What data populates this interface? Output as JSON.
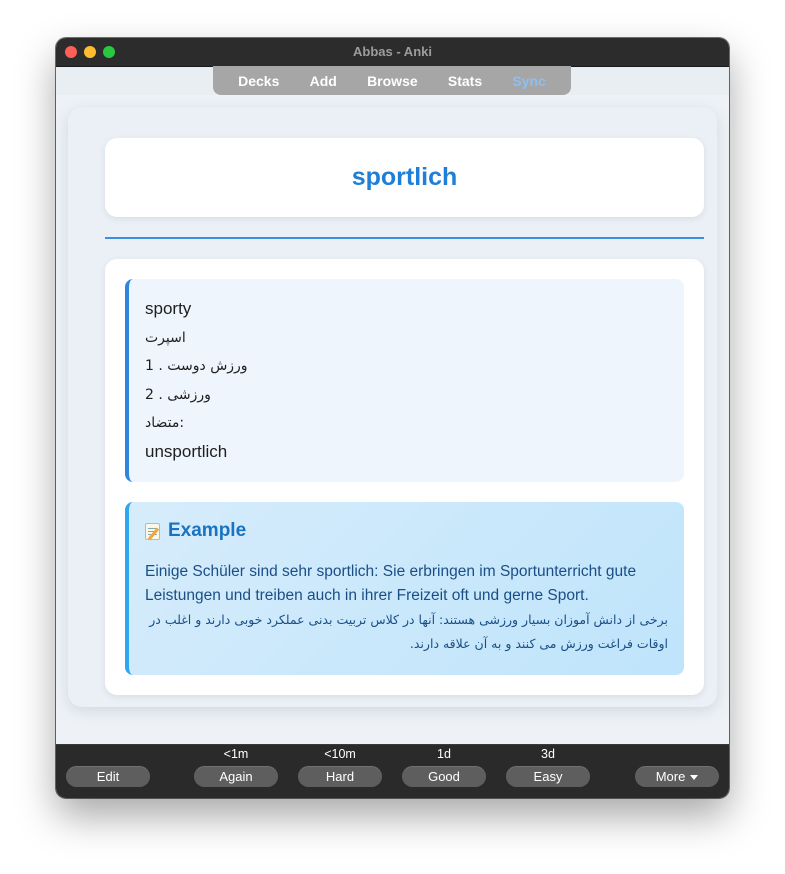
{
  "window": {
    "title": "Abbas - Anki"
  },
  "toolbar": {
    "decks": "Decks",
    "add": "Add",
    "browse": "Browse",
    "stats": "Stats",
    "sync": "Sync"
  },
  "card": {
    "front_word": "sportlich",
    "meaning": {
      "english": "sporty",
      "persian_word": "اسپرت",
      "sense1": "1 . ورزش دوست",
      "sense2": "2 . ورزشی",
      "antonym_label": "متضاد:",
      "antonym": "unsportlich"
    },
    "example": {
      "icon": "memo-icon",
      "title": "Example",
      "german": "Einige Schüler sind sehr sportlich: Sie erbringen im Sportunterricht gute Leistungen und treiben auch in ihrer Freizeit oft und gerne Sport.",
      "persian": "برخی از دانش آموزان بسیار ورزشی هستند: آنها در کلاس تربیت بدنی عملکرد خوبی دارند و اغلب در اوقات فراغت ورزش می کنند و به آن علاقه دارند."
    }
  },
  "answer_bar": {
    "edit": "Edit",
    "again": {
      "label": "Again",
      "due": "<1m"
    },
    "hard": {
      "label": "Hard",
      "due": "<10m"
    },
    "good": {
      "label": "Good",
      "due": "1d"
    },
    "easy": {
      "label": "Easy",
      "due": "3d"
    },
    "more": "More"
  },
  "colors": {
    "accent": "#1e7fd8",
    "titlebar": "#2c2c2c",
    "button": "#5e5e5e"
  }
}
